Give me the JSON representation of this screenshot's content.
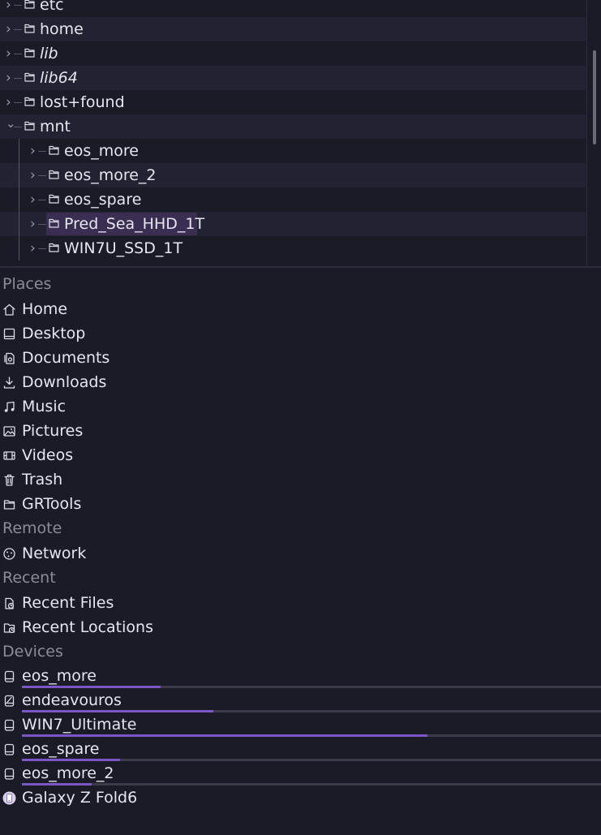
{
  "tree": {
    "rows": [
      {
        "label": "etc",
        "italic": false,
        "depth": 0,
        "expanded": false
      },
      {
        "label": "home",
        "italic": false,
        "depth": 0,
        "expanded": false
      },
      {
        "label": "lib",
        "italic": true,
        "depth": 0,
        "expanded": false
      },
      {
        "label": "lib64",
        "italic": true,
        "depth": 0,
        "expanded": false
      },
      {
        "label": "lost+found",
        "italic": false,
        "depth": 0,
        "expanded": false
      },
      {
        "label": "mnt",
        "italic": false,
        "depth": 0,
        "expanded": true
      },
      {
        "label": "eos_more",
        "italic": false,
        "depth": 1,
        "expanded": false
      },
      {
        "label": "eos_more_2",
        "italic": false,
        "depth": 1,
        "expanded": false
      },
      {
        "label": "eos_spare",
        "italic": false,
        "depth": 1,
        "expanded": false
      },
      {
        "label": "Pred_Sea_HHD_1T",
        "italic": false,
        "depth": 1,
        "expanded": false,
        "selected": true
      },
      {
        "label": "WIN7U_SSD_1T",
        "italic": false,
        "depth": 1,
        "expanded": false
      }
    ]
  },
  "places": {
    "heading": "Places",
    "items": [
      {
        "label": "Home",
        "icon": "home-icon"
      },
      {
        "label": "Desktop",
        "icon": "desktop-icon"
      },
      {
        "label": "Documents",
        "icon": "documents-icon"
      },
      {
        "label": "Downloads",
        "icon": "downloads-icon"
      },
      {
        "label": "Music",
        "icon": "music-icon"
      },
      {
        "label": "Pictures",
        "icon": "pictures-icon"
      },
      {
        "label": "Videos",
        "icon": "videos-icon"
      },
      {
        "label": "Trash",
        "icon": "trash-icon"
      },
      {
        "label": "GRTools",
        "icon": "folder-icon"
      }
    ]
  },
  "remote": {
    "heading": "Remote",
    "items": [
      {
        "label": "Network",
        "icon": "network-icon"
      }
    ]
  },
  "recent": {
    "heading": "Recent",
    "items": [
      {
        "label": "Recent Files",
        "icon": "recent-files-icon"
      },
      {
        "label": "Recent Locations",
        "icon": "recent-locations-icon"
      }
    ]
  },
  "devices": {
    "heading": "Devices",
    "items": [
      {
        "label": "eos_more",
        "icon": "drive-icon",
        "usage": 0.24
      },
      {
        "label": "endeavouros",
        "icon": "root-drive-icon",
        "usage": 0.33
      },
      {
        "label": "WIN7_Ultimate",
        "icon": "drive-icon",
        "usage": 0.7
      },
      {
        "label": "eos_spare",
        "icon": "drive-icon",
        "usage": 0.17
      },
      {
        "label": "eos_more_2",
        "icon": "drive-icon",
        "usage": 0.12
      },
      {
        "label": "Galaxy Z Fold6",
        "icon": "phone-icon",
        "usage": null
      }
    ]
  },
  "colors": {
    "accent": "#7b56c4",
    "selection": "#3a2f52",
    "background": "#1b1b27"
  }
}
